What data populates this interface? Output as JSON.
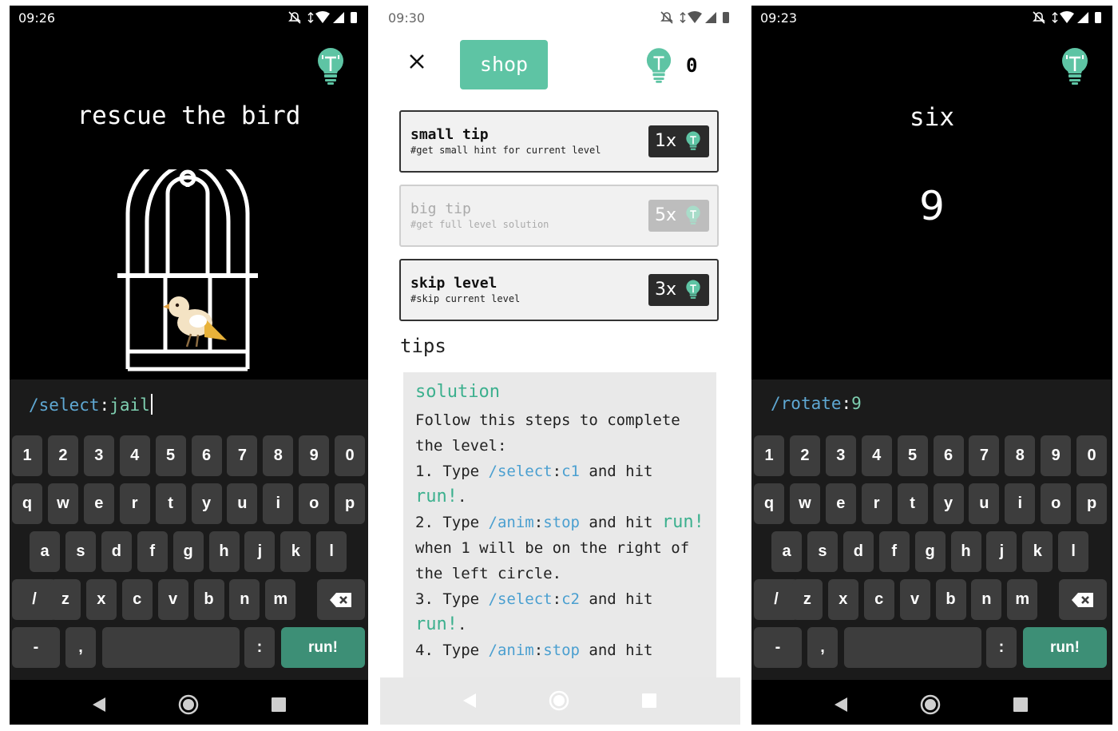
{
  "screen1": {
    "status_time": "09:26",
    "title": "rescue the bird",
    "command": {
      "slash": "/",
      "name": "select",
      "colon": ":",
      "value": "jail"
    }
  },
  "screen2": {
    "status_time": "09:30",
    "shop_label": "shop",
    "tip_count": "0",
    "items": [
      {
        "title": "small tip",
        "desc": "#get small hint for current level",
        "cost": "1x",
        "enabled": true
      },
      {
        "title": "big tip",
        "desc": "#get full level solution",
        "cost": "5x",
        "enabled": false
      },
      {
        "title": "skip level",
        "desc": "#skip current level",
        "cost": "3x",
        "enabled": true
      }
    ],
    "tips_heading": "tips",
    "solution": {
      "title": "solution",
      "intro": "Follow this steps to complete the level:",
      "step1": {
        "num": "1. Type ",
        "slash": "/",
        "cmd": "select",
        "colon": ":",
        "arg": "c1",
        "after": " and hit",
        "run": "run!",
        "end": "."
      },
      "step2": {
        "num": "2. Type ",
        "slash": "/",
        "cmd": "anim",
        "colon": ":",
        "arg": "stop",
        "after": " and hit",
        "run": "run!",
        "end": " when 1 will be on the right of the left circle."
      },
      "step3": {
        "num": "3. Type ",
        "slash": "/",
        "cmd": "select",
        "colon": ":",
        "arg": "c2",
        "after": " and hit",
        "run": "run!",
        "end": "."
      },
      "step4": {
        "num": "4. Type ",
        "slash": "/",
        "cmd": "anim",
        "colon": ":",
        "arg": "stop",
        "after": " and hit"
      }
    }
  },
  "screen3": {
    "status_time": "09:23",
    "title": "six",
    "number": "9",
    "command": {
      "slash": "/",
      "name": "rotate",
      "colon": ":",
      "value": "9"
    }
  },
  "keyboard": {
    "row1": [
      "1",
      "2",
      "3",
      "4",
      "5",
      "6",
      "7",
      "8",
      "9",
      "0"
    ],
    "row2": [
      "q",
      "w",
      "e",
      "r",
      "t",
      "y",
      "u",
      "i",
      "o",
      "p"
    ],
    "row3": [
      "a",
      "s",
      "d",
      "f",
      "g",
      "h",
      "j",
      "k",
      "l"
    ],
    "row4": [
      "/",
      "z",
      "x",
      "c",
      "v",
      "b",
      "n",
      "m"
    ],
    "dash": "-",
    "comma": ",",
    "colon": ":",
    "run": "run!"
  },
  "colors": {
    "accent": "#5ec4a4",
    "run_key": "#3d8f76",
    "command_blue": "#5fa8d3"
  },
  "icons": {
    "bulb": "lightbulb-icon",
    "close": "close-icon",
    "backspace": "backspace-icon",
    "back": "nav-back-icon",
    "home": "nav-home-icon",
    "recents": "nav-recents-icon"
  }
}
